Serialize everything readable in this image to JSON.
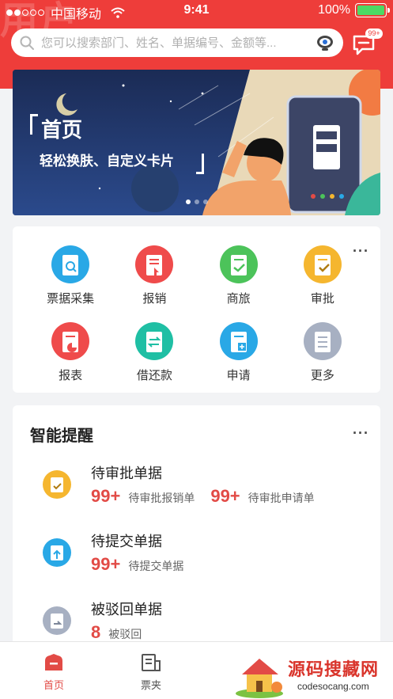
{
  "status_bar": {
    "carrier": "中国移动",
    "time": "9:41",
    "battery": "100%",
    "battery_level": 1.0
  },
  "header": {
    "ghost_text": "用户",
    "search_placeholder": "您可以搜索部门、姓名、单据编号、金额等...",
    "message_badge": "99+"
  },
  "banner": {
    "title": "首页",
    "subtitle": "轻松换肤、自定义卡片",
    "pages": 3,
    "active_page": 1
  },
  "menu": {
    "more_label": "···",
    "items": [
      {
        "label": "票据采集",
        "icon": "receipt-scan-icon",
        "color": "#29a8e6"
      },
      {
        "label": "报销",
        "icon": "reimburse-icon",
        "color": "#ef4b4b"
      },
      {
        "label": "商旅",
        "icon": "travel-icon",
        "color": "#4cc35a"
      },
      {
        "label": "审批",
        "icon": "approval-icon",
        "color": "#f5b62f"
      },
      {
        "label": "报表",
        "icon": "report-icon",
        "color": "#ef4b4b"
      },
      {
        "label": "借还款",
        "icon": "loan-icon",
        "color": "#1fbfa4"
      },
      {
        "label": "申请",
        "icon": "apply-icon",
        "color": "#29a8e6"
      },
      {
        "label": "更多",
        "icon": "more-apps-icon",
        "color": "#a7b0c2"
      }
    ]
  },
  "reminders": {
    "title": "智能提醒",
    "more_label": "···",
    "items": [
      {
        "name": "待审批单据",
        "icon": "pending-approval-icon",
        "color": "#f5b62f",
        "stats": [
          {
            "num": "99+",
            "label": "待审批报销单"
          },
          {
            "num": "99+",
            "label": "待审批申请单"
          }
        ]
      },
      {
        "name": "待提交单据",
        "icon": "pending-submit-icon",
        "color": "#29a8e6",
        "stats": [
          {
            "num": "99+",
            "label": "待提交单据"
          }
        ]
      },
      {
        "name": "被驳回单据",
        "icon": "rejected-icon",
        "color": "#a7b0c2",
        "stats": [
          {
            "num": "8",
            "label": "被驳回"
          }
        ]
      }
    ]
  },
  "tabs": [
    {
      "label": "首页",
      "icon": "home-icon",
      "active": true
    },
    {
      "label": "票夹",
      "icon": "ticket-folder-icon",
      "active": false
    }
  ],
  "watermark": {
    "text": "源码搜藏网",
    "url": "codesocang.com"
  },
  "colors": {
    "brand_red": "#ee3d3a",
    "number_red": "#e24b46",
    "background": "#f2f3f5"
  }
}
